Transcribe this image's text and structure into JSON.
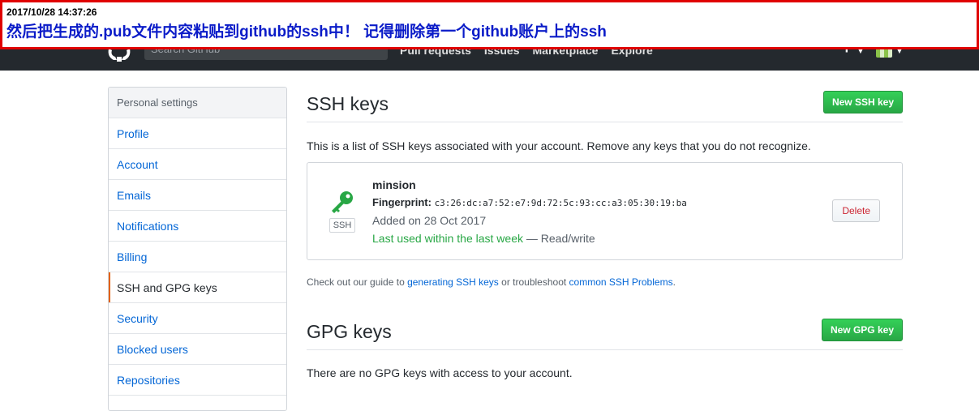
{
  "annotation": {
    "timestamp": "2017/10/28 14:37:26",
    "message": "然后把生成的.pub文件内容粘贴到github的ssh中！ 记得删除第一个github账户上的ssh"
  },
  "header": {
    "search_placeholder": "Search GitHub",
    "nav": [
      "Pull requests",
      "Issues",
      "Marketplace",
      "Explore"
    ],
    "plus": "+"
  },
  "sidebar": {
    "title": "Personal settings",
    "items": [
      {
        "label": "Profile"
      },
      {
        "label": "Account"
      },
      {
        "label": "Emails"
      },
      {
        "label": "Notifications"
      },
      {
        "label": "Billing"
      },
      {
        "label": "SSH and GPG keys",
        "selected": true
      },
      {
        "label": "Security"
      },
      {
        "label": "Blocked users"
      },
      {
        "label": "Repositories"
      }
    ]
  },
  "ssh": {
    "title": "SSH keys",
    "new_button": "New SSH key",
    "description": "This is a list of SSH keys associated with your account. Remove any keys that you do not recognize.",
    "key": {
      "badge": "SSH",
      "title": "minsion",
      "fingerprint_label": "Fingerprint:",
      "fingerprint": "c3:26:dc:a7:52:e7:9d:72:5c:93:cc:a3:05:30:19:ba",
      "added": "Added on 28 Oct 2017",
      "last_used": "Last used within the last week",
      "access": " — Read/write",
      "delete_button": "Delete"
    },
    "guide": {
      "prefix": "Check out our guide to ",
      "link1": "generating SSH keys",
      "middle": " or troubleshoot ",
      "link2": "common SSH Problems",
      "suffix": "."
    }
  },
  "gpg": {
    "title": "GPG keys",
    "new_button": "New GPG key",
    "description": "There are no GPG keys with access to your account."
  },
  "colors": {
    "header_bg": "#24292e",
    "link": "#0366d6",
    "primary_green": "#28a745",
    "danger": "#cb2431",
    "annotation_border": "#e00000",
    "annotation_text": "#0a1bc8"
  }
}
